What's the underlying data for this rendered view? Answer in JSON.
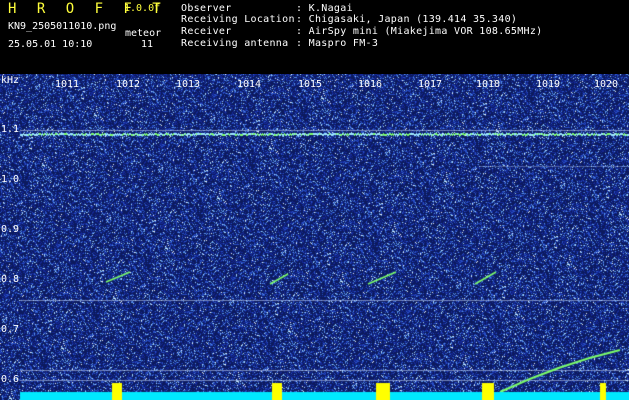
{
  "header": {
    "app_title": "H R O F F T",
    "version": "1.0.0f",
    "filename": "KN9_2505011010.png",
    "datetime": "25.05.01 10:10",
    "meteor_label": "meteor",
    "meteor_count": "11",
    "fields": [
      {
        "label": "Observer",
        "value": ": K.Nagai"
      },
      {
        "label": "Receiving Location",
        "value": ": Chigasaki, Japan (139.414 35.340)"
      },
      {
        "label": "Receiver",
        "value": ": AirSpy mini (Miakejima VOR 108.65MHz)"
      },
      {
        "label": "Receiving antenna",
        "value": ": Maspro FM-3"
      }
    ]
  },
  "axes": {
    "y_unit": "kHz",
    "x_ticks": [
      "1011",
      "1012",
      "1013",
      "1014",
      "1015",
      "1016",
      "1017",
      "1018",
      "1019",
      "1020"
    ],
    "y_ticks": [
      "1.1",
      "1.0",
      "0.9",
      "0.8",
      "0.7",
      "0.6"
    ]
  },
  "colors": {
    "background_noise": "#102070",
    "carrier_line": "#9ee8ff",
    "signal_green": "#7dff6a",
    "bottom_level": "#00e8ff",
    "level_peaks": "#ffff00",
    "text": "#ffffff",
    "header_accent": "#ffff3c"
  }
}
